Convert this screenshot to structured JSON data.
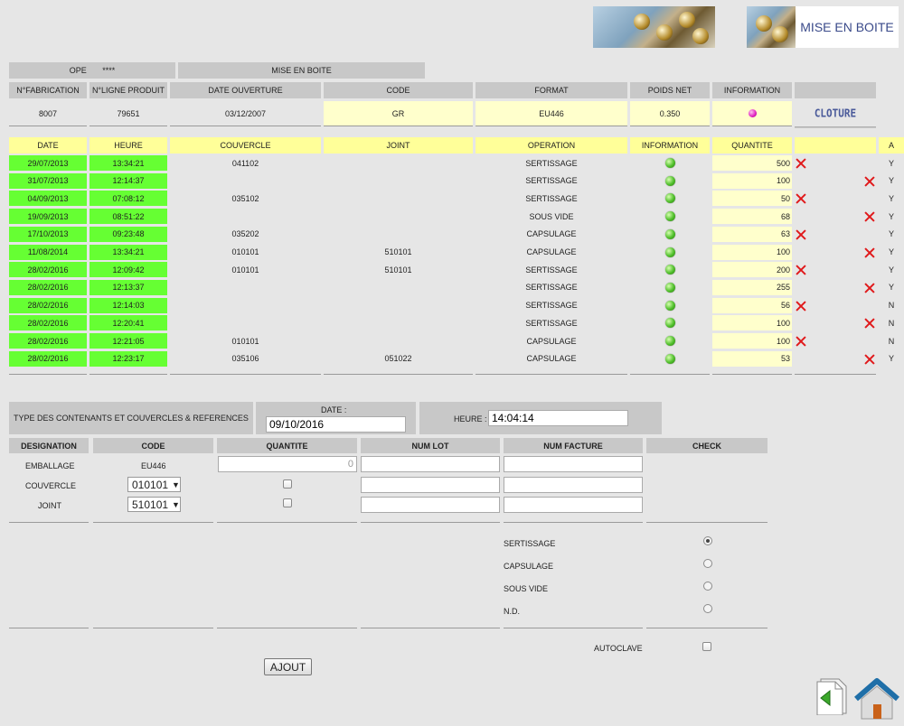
{
  "header": {
    "title": "MISE EN BOITE"
  },
  "top_info": {
    "ope_label": "OPE",
    "ope_value": "****",
    "section": "MISE EN BOITE"
  },
  "fabrication_table": {
    "headers": [
      "N°FABRICATION",
      "N°LIGNE PRODUIT",
      "DATE OUVERTURE",
      "CODE",
      "FORMAT",
      "POIDS NET",
      "INFORMATION"
    ],
    "row": {
      "fabrication": "8007",
      "ligne_produit": "79651",
      "date_ouverture": "03/12/2007",
      "code": "GR",
      "format": "EU446",
      "poids_net": "0.350"
    },
    "cloture_label": "CLOTURE"
  },
  "ops_table": {
    "headers": [
      "DATE",
      "HEURE",
      "COUVERCLE",
      "JOINT",
      "OPERATION",
      "INFORMATION",
      "QUANTITE",
      "",
      "A"
    ],
    "rows": [
      {
        "date": "29/07/2013",
        "heure": "13:34:21",
        "couvercle": "041102",
        "joint": "",
        "operation": "SERTISSAGE",
        "quantite": "500",
        "x": "left",
        "a": "Y"
      },
      {
        "date": "31/07/2013",
        "heure": "12:14:37",
        "couvercle": "",
        "joint": "",
        "operation": "SERTISSAGE",
        "quantite": "100",
        "x": "right",
        "a": "Y"
      },
      {
        "date": "04/09/2013",
        "heure": "07:08:12",
        "couvercle": "035102",
        "joint": "",
        "operation": "SERTISSAGE",
        "quantite": "50",
        "x": "left",
        "a": "Y"
      },
      {
        "date": "19/09/2013",
        "heure": "08:51:22",
        "couvercle": "",
        "joint": "",
        "operation": "SOUS VIDE",
        "quantite": "68",
        "x": "right",
        "a": "Y"
      },
      {
        "date": "17/10/2013",
        "heure": "09:23:48",
        "couvercle": "035202",
        "joint": "",
        "operation": "CAPSULAGE",
        "quantite": "63",
        "x": "left",
        "a": "Y"
      },
      {
        "date": "11/08/2014",
        "heure": "13:34:21",
        "couvercle": "010101",
        "joint": "510101",
        "operation": "CAPSULAGE",
        "quantite": "100",
        "x": "right",
        "a": "Y"
      },
      {
        "date": "28/02/2016",
        "heure": "12:09:42",
        "couvercle": "010101",
        "joint": "510101",
        "operation": "SERTISSAGE",
        "quantite": "200",
        "x": "left",
        "a": "Y"
      },
      {
        "date": "28/02/2016",
        "heure": "12:13:37",
        "couvercle": "",
        "joint": "",
        "operation": "SERTISSAGE",
        "quantite": "255",
        "x": "right",
        "a": "Y"
      },
      {
        "date": "28/02/2016",
        "heure": "12:14:03",
        "couvercle": "",
        "joint": "",
        "operation": "SERTISSAGE",
        "quantite": "56",
        "x": "left",
        "a": "N"
      },
      {
        "date": "28/02/2016",
        "heure": "12:20:41",
        "couvercle": "",
        "joint": "",
        "operation": "SERTISSAGE",
        "quantite": "100",
        "x": "right",
        "a": "N"
      },
      {
        "date": "28/02/2016",
        "heure": "12:21:05",
        "couvercle": "010101",
        "joint": "",
        "operation": "CAPSULAGE",
        "quantite": "100",
        "x": "left",
        "a": "N"
      },
      {
        "date": "28/02/2016",
        "heure": "12:23:17",
        "couvercle": "035106",
        "joint": "051022",
        "operation": "CAPSULAGE",
        "quantite": "53",
        "x": "right",
        "a": "Y"
      }
    ]
  },
  "form": {
    "type_label": "TYPE DES CONTENANTS ET COUVERCLES & REFERENCES",
    "date_label": "DATE :",
    "date_value": "09/10/2016",
    "heure_label": "HEURE :",
    "heure_value": "14:04:14",
    "headers": [
      "DESIGNATION",
      "CODE",
      "QUANTITE",
      "NUM LOT",
      "NUM FACTURE",
      "CHECK"
    ],
    "emballage_label": "EMBALLAGE",
    "emballage_code": "EU446",
    "emballage_qty": "0",
    "couvercle_label": "COUVERCLE",
    "couvercle_code": "010101",
    "joint_label": "JOINT",
    "joint_code": "510101",
    "operations": [
      "SERTISSAGE",
      "CAPSULAGE",
      "SOUS VIDE",
      "N.D."
    ],
    "autoclave_label": "AUTOCLAVE",
    "add_button": "AJOUT"
  }
}
